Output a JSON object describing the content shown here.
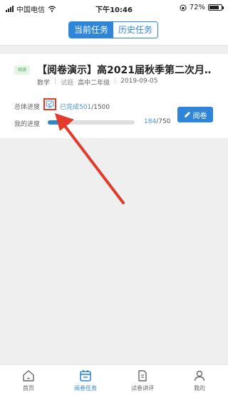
{
  "status_bar": {
    "carrier": "中国电信",
    "time": "下午10:46",
    "battery": "72%"
  },
  "tabs": [
    {
      "label": "当前任务",
      "active": true
    },
    {
      "label": "历史任务",
      "active": false
    }
  ],
  "task": {
    "badge": "阅读",
    "title": "【阅卷演示】高2021届秋季第二次月…",
    "subject": "数学",
    "type_label": "试题",
    "grade": "高中二年级",
    "date": "2019-09-05",
    "overall_label": "总体进度",
    "overall_completed_text": "已完成501",
    "overall_total_text": "/1500",
    "my_label": "我的进度",
    "my_completed": "184",
    "my_total_text": "/750",
    "my_progress_fraction": 0.245,
    "grade_button": "阅卷"
  },
  "nav": [
    {
      "label": "首页",
      "icon": "home-icon",
      "active": false
    },
    {
      "label": "阅卷任务",
      "icon": "calendar-icon",
      "active": true
    },
    {
      "label": "试卷讲评",
      "icon": "document-icon",
      "active": false
    },
    {
      "label": "我的",
      "icon": "person-icon",
      "active": false
    }
  ],
  "colors": {
    "accent": "#2f86d8",
    "annotation": "#e23b2c",
    "badge_bg": "#e4f5e6",
    "badge_text": "#49a55a"
  }
}
